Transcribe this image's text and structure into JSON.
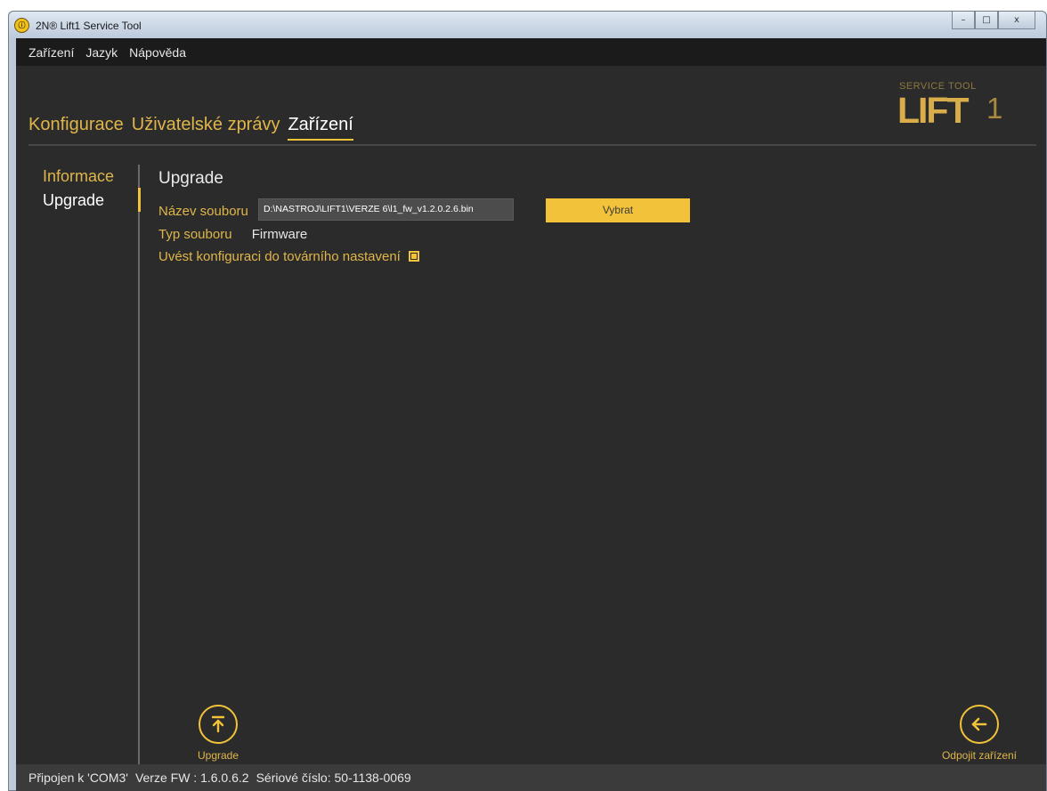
{
  "window": {
    "title": "2N® Lift1 Service Tool",
    "controls": {
      "minimize": "–",
      "maximize": "□",
      "close": "x"
    }
  },
  "menu": [
    "Zařízení",
    "Jazyk",
    "Nápověda"
  ],
  "logo": {
    "top": "SERVICE TOOL",
    "main": "LIFT",
    "suffix": "1"
  },
  "tabs": [
    {
      "label": "Konfigurace",
      "active": false
    },
    {
      "label": "Uživatelské zprávy",
      "active": false
    },
    {
      "label": "Zařízení",
      "active": true
    }
  ],
  "sidenav": [
    {
      "label": "Informace",
      "active": false
    },
    {
      "label": "Upgrade",
      "active": true
    }
  ],
  "upgrade": {
    "title": "Upgrade",
    "filename_label": "Název souboru",
    "filename_value": "D:\\NASTROJ\\LIFT1\\VERZE 6\\l1_fw_v1.2.0.2.6.bin",
    "select_button": "Vybrat",
    "filetype_label": "Typ souboru",
    "filetype_value": "Firmware",
    "factory_reset_label": "Uvést konfiguraci do továrního nastavení",
    "factory_reset_checked": true
  },
  "actions": {
    "upgrade_label": "Upgrade",
    "disconnect_label": "Odpojit zařízení"
  },
  "status": {
    "connected": "Připojen k 'COM3'",
    "fw": "Verze FW : 1.6.0.6.2",
    "serial": "Sériové číslo: 50-1138-0069"
  },
  "colors": {
    "accent": "#f2c33a",
    "background": "#2b2b2b",
    "menubar": "#1b1b1b"
  }
}
